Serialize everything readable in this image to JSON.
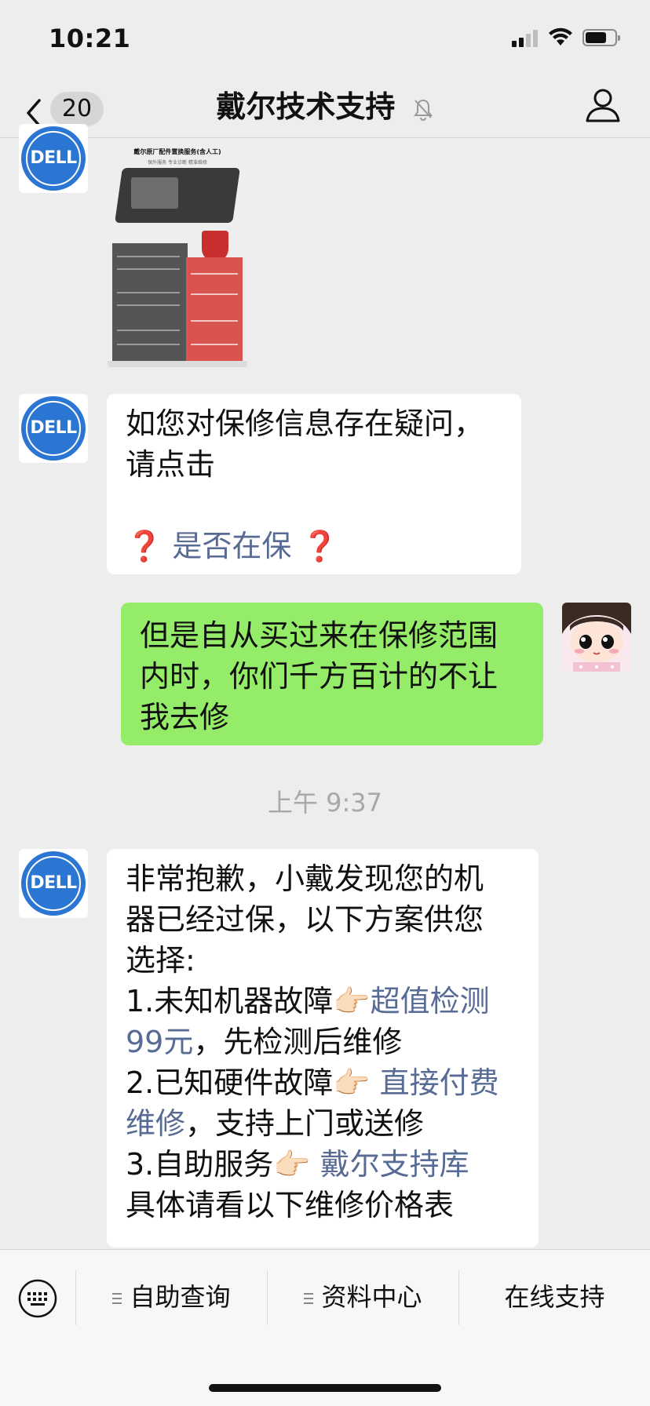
{
  "status_bar": {
    "time": "10:21"
  },
  "nav": {
    "back_count": "20",
    "title": "戴尔技术支持",
    "title_icon": "bell-mute-icon",
    "right_icon": "profile-icon"
  },
  "brand": {
    "avatar_text": "DELL",
    "avatar_color": "#2a76d2"
  },
  "messages": {
    "poster": {
      "title": "戴尔原厂配件置换服务(含人工)",
      "subtitle": "保外服务 专业诊断 精准维修"
    },
    "msg1": {
      "line1": "如您对保修信息存在疑问，",
      "line2": "请点击",
      "q_left": "❓",
      "link": "是否在保",
      "q_right": "❓"
    },
    "msg2": {
      "line1": "但是自从买过来在保修范围",
      "line2": "内时，你们千方百计的不让",
      "line3": "我去修"
    },
    "timestamp": "上午 9:37",
    "msg3": {
      "line1": "非常抱歉，小戴发现您的机",
      "line2": "器已经过保，以下方案供您",
      "line3": "选择:",
      "item1_prefix": "1.未知机器故障",
      "item1_emoji": "👉🏻",
      "item1_link_a": "超值检测",
      "item1_link_b": "99元",
      "item1_suffix": "，先检测后维修",
      "item2_prefix": "2.已知硬件故障",
      "item2_emoji": "👉🏻",
      "item2_link_a": " 直接付费",
      "item2_link_b": "维修",
      "item2_suffix": "，支持上门或送修",
      "item3_prefix": "3.自助服务",
      "item3_emoji": "👉🏻",
      "item3_link": " 戴尔支持库",
      "last_line": "具体请看以下维修价格表"
    }
  },
  "menu": {
    "keyboard_icon": "keyboard-icon",
    "items": [
      {
        "label": "自助查询"
      },
      {
        "label": "资料中心"
      },
      {
        "label": "在线支持"
      }
    ]
  }
}
